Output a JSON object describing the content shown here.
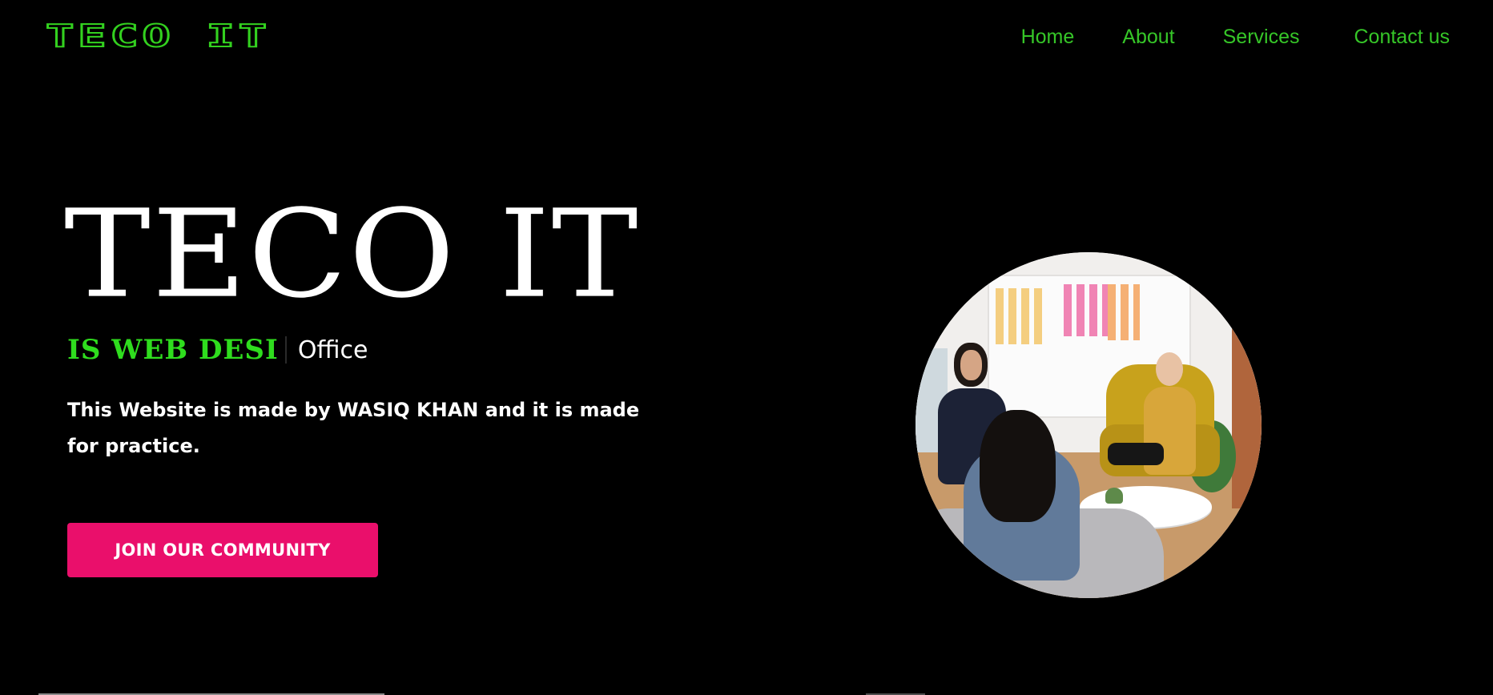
{
  "header": {
    "logo_text": "TECO IT",
    "nav": [
      {
        "label": "Home"
      },
      {
        "label": "About"
      },
      {
        "label": "Services"
      },
      {
        "label": "Contact us"
      }
    ]
  },
  "hero": {
    "title": "TECO IT",
    "typing_text": "IS WEB DESI",
    "static_word": "Office",
    "description": "This Website is made by WASIQ KHAN and it is made for practice.",
    "cta_label": "JOIN OUR COMMUNITY",
    "image_icon": "office-meeting-photo"
  },
  "colors": {
    "background": "#000000",
    "accent_green": "#36c628",
    "typing_green": "#2fdd1e",
    "cta_pink": "#ea0f6b",
    "text_white": "#ffffff"
  }
}
